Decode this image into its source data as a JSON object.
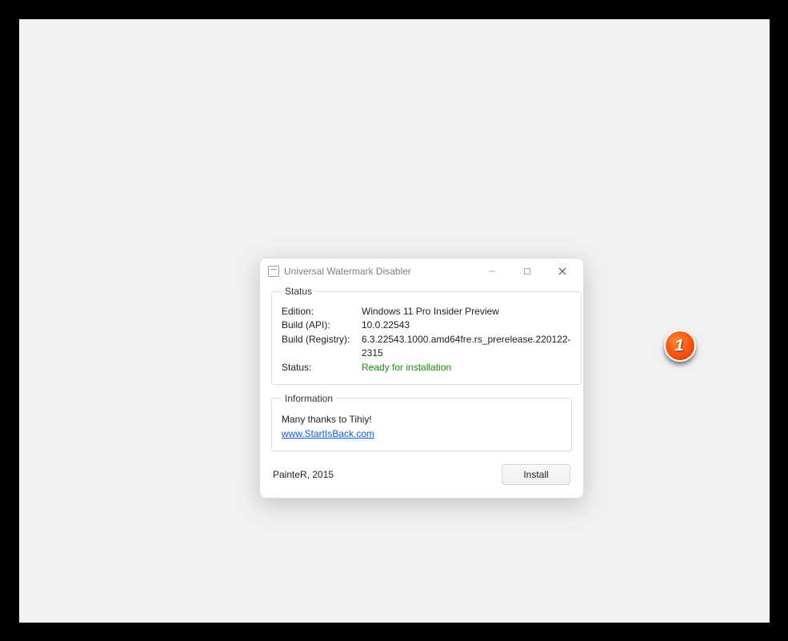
{
  "window": {
    "title": "Universal Watermark Disabler"
  },
  "status": {
    "legend": "Status",
    "edition_label": "Edition:",
    "edition_value": "Windows 11 Pro Insider Preview",
    "build_api_label": "Build (API):",
    "build_api_value": "10.0.22543",
    "build_reg_label": "Build (Registry):",
    "build_reg_value": "6.3.22543.1000.amd64fre.rs_prerelease.220122-2315",
    "status_label": "Status:",
    "status_value": "Ready for installation"
  },
  "info": {
    "legend": "Information",
    "thanks": "Many thanks to Tihiy!",
    "link_text": "www.StartIsBack.com"
  },
  "footer": {
    "credit": "PainteR, 2015",
    "install_label": "Install"
  },
  "callout": {
    "number": "1"
  }
}
